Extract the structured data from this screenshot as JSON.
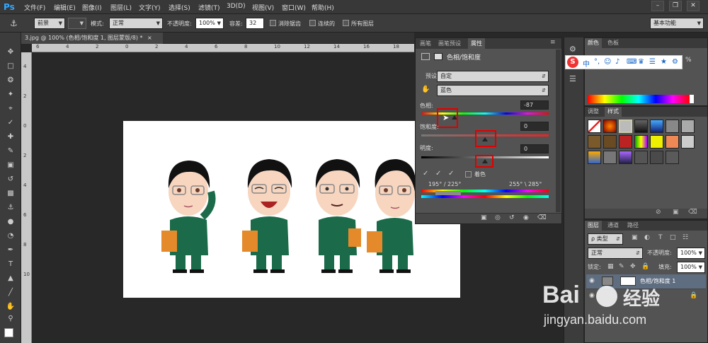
{
  "app": {
    "logo": "Ps"
  },
  "menu": [
    "文件(F)",
    "编辑(E)",
    "图像(I)",
    "图层(L)",
    "文字(Y)",
    "选择(S)",
    "滤镜(T)",
    "3D(D)",
    "视图(V)",
    "窗口(W)",
    "帮助(H)"
  ],
  "window_buttons": [
    "–",
    "❐",
    "✕"
  ],
  "options": {
    "fill_source": "前景",
    "mode_label": "模式:",
    "mode_value": "正常",
    "opacity_label": "不透明度:",
    "opacity_value": "100%",
    "tolerance_label": "容差:",
    "tolerance_value": "32",
    "antialias": "消除锯齿",
    "contiguous": "连续的",
    "all_layers": "所有图层",
    "workspace": "基本功能"
  },
  "document": {
    "tab_title": "3.jpg @ 100% (色相/饱和度 1, 图层蒙版/8) *"
  },
  "ruler": {
    "h_labels": [
      "6",
      "4",
      "2",
      "0",
      "2",
      "4",
      "6",
      "8",
      "10",
      "12",
      "14",
      "16",
      "18"
    ],
    "v_labels": [
      "4",
      "2",
      "0",
      "2",
      "4",
      "6",
      "8",
      "10"
    ]
  },
  "properties": {
    "tabs": [
      "画笔",
      "画笔预设",
      "属性"
    ],
    "title": "色相/饱和度",
    "preset_label": "预设:",
    "preset_value": "自定",
    "channel_value": "蓝色",
    "hue_label": "色相:",
    "hue_value": "-87",
    "saturation_label": "饱和度:",
    "saturation_value": "0",
    "lightness_label": "明度:",
    "lightness_value": "0",
    "colorize_label": "着色",
    "range_left": "195° / 225°",
    "range_right": "255° \\ 285°",
    "hue_fraction": 0.26,
    "saturation_fraction": 0.5,
    "lightness_fraction": 0.5
  },
  "color_panel": {
    "tabs": [
      "颜色",
      "色板"
    ]
  },
  "styles_panel": {
    "tabs": [
      "调整",
      "样式"
    ]
  },
  "layers_panel": {
    "tabs": [
      "图层",
      "通道",
      "路径"
    ],
    "kind_label": "ρ 类型",
    "blend_mode": "正常",
    "opacity_label": "不透明度:",
    "opacity_value": "100%",
    "lock_label": "锁定:",
    "fill_label": "填充:",
    "fill_value": "100%",
    "layer_name": "色相/饱和度 1"
  },
  "ime": {
    "logo": "S",
    "items": [
      "中",
      "°,",
      "☺",
      "♪",
      "⌨",
      "♛",
      "☰",
      "★",
      "⚙"
    ],
    "percent": "%"
  },
  "watermark": {
    "brand": "Bai",
    "brand2": "经验",
    "url": "jingyan.baidu.com"
  }
}
